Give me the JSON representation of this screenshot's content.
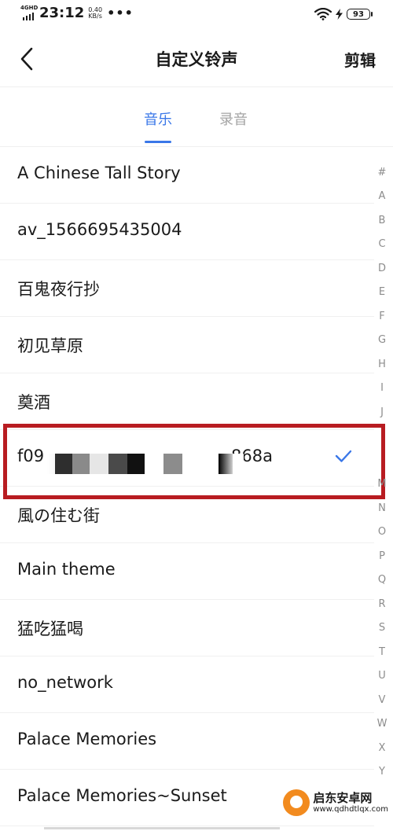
{
  "status_bar": {
    "network_label": "4GHD",
    "time": "23:12",
    "speed_value": "0.40",
    "speed_unit": "KB/s",
    "more": "•••",
    "battery_level": "93"
  },
  "header": {
    "title": "自定义铃声",
    "edit_label": "剪辑"
  },
  "tabs": [
    {
      "label": "音乐",
      "active": true
    },
    {
      "label": "录音",
      "active": false
    }
  ],
  "songs": [
    {
      "title": "A Chinese Tall Story"
    },
    {
      "title": "av_1566695435004"
    },
    {
      "title": "百鬼夜行抄"
    },
    {
      "title": "初见草原"
    },
    {
      "title": "奠酒"
    },
    {
      "title_start": "f09",
      "title_end": "868a",
      "selected": true
    },
    {
      "title": "風の住む街"
    },
    {
      "title": "Main theme"
    },
    {
      "title": "猛吃猛喝"
    },
    {
      "title": "no_network"
    },
    {
      "title": "Palace Memories"
    },
    {
      "title": "Palace Memories~Sunset"
    }
  ],
  "alphabet_index": [
    "#",
    "A",
    "B",
    "C",
    "D",
    "E",
    "F",
    "G",
    "H",
    "I",
    "J",
    "K",
    "L",
    "M",
    "N",
    "O",
    "P",
    "Q",
    "R",
    "S",
    "T",
    "U",
    "V",
    "W",
    "X",
    "Y"
  ],
  "watermark": {
    "name": "启东安卓网",
    "url": "www.qdhdtlqx.com"
  },
  "colors": {
    "accent": "#3a77e8",
    "highlight_box": "#b81c21",
    "inactive_tab": "#a4a4a4",
    "index_text": "#8c8c8c"
  }
}
